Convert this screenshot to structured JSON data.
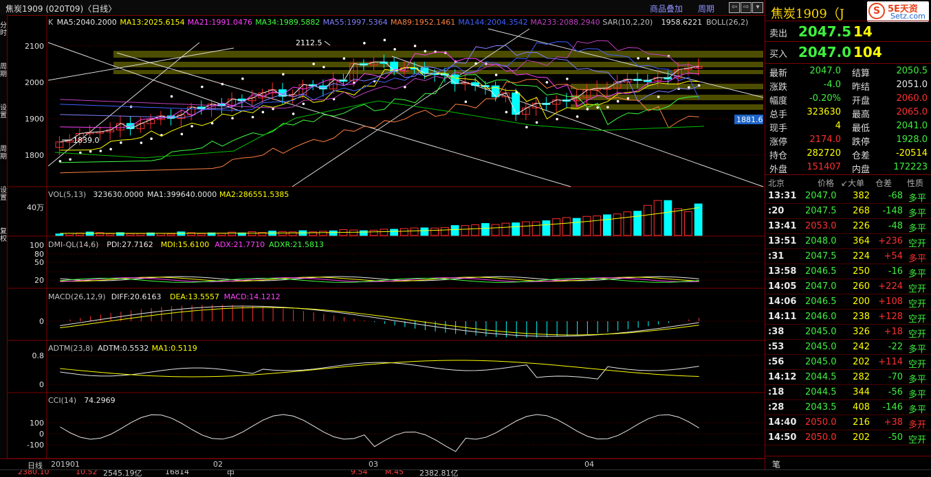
{
  "window": {
    "title": "焦炭1909 (020T09)〈日线〉",
    "links": [
      "商品叠加",
      "周期"
    ],
    "scroll_buttons": [
      "⇦",
      "⇨",
      "▾"
    ]
  },
  "left_sidebar": [
    "分时",
    "周期",
    "设置",
    "周期",
    "设置",
    "复权"
  ],
  "main_chart": {
    "indicator_line": [
      {
        "text": "K",
        "color": "#c0c0c0"
      },
      {
        "text": "MA5:2040.2000",
        "color": "#e8e8e8"
      },
      {
        "text": "MA13:2025.6154",
        "color": "#ffff00"
      },
      {
        "text": "MA21:1991.0476",
        "color": "#ff40ff"
      },
      {
        "text": "MA34:1989.5882",
        "color": "#40ff40"
      },
      {
        "text": "MA55:1997.5364",
        "color": "#8080ff"
      },
      {
        "text": "MA89:1952.1461",
        "color": "#ff8040"
      },
      {
        "text": "MA144:2004.3542",
        "color": "#4060ff"
      },
      {
        "text": "MA233:2088.2940",
        "color": "#c040c0"
      },
      {
        "text": "SAR(10,2,20)",
        "color": "#c0c0c0"
      },
      {
        "text": "1958.6221",
        "color": "#e8e8e8"
      },
      {
        "text": "BOLL(26,2)",
        "color": "#c0c0c0"
      }
    ],
    "y_ticks": [
      "2100",
      "2000",
      "1900",
      "1800"
    ],
    "annotation_high": "2112.5",
    "annotation_low": "1839.0",
    "price_marker": "1881.6"
  },
  "volume": {
    "header": [
      {
        "text": "VOL(5,13)",
        "color": "#c0c0c0"
      },
      {
        "text": "323630.0000",
        "color": "#e8e8e8"
      },
      {
        "text": "MA1:399640.0000",
        "color": "#e8e8e8"
      },
      {
        "text": "MA2:286551.5385",
        "color": "#ffff00"
      }
    ],
    "y_tick": "40万"
  },
  "dmi": {
    "header": [
      {
        "text": "DMI-QL(14,6)",
        "color": "#c0c0c0"
      },
      {
        "text": "PDI:27.7162",
        "color": "#e8e8e8"
      },
      {
        "text": "MDI:15.6100",
        "color": "#ffff00"
      },
      {
        "text": "ADX:21.7710",
        "color": "#ff40ff"
      },
      {
        "text": "ADXR:21.5813",
        "color": "#40ff40"
      }
    ],
    "y_ticks": [
      "100",
      "80",
      "50",
      "20"
    ]
  },
  "macd": {
    "header": [
      {
        "text": "MACD(26,12,9)",
        "color": "#c0c0c0"
      },
      {
        "text": "DIFF:20.6163",
        "color": "#e8e8e8"
      },
      {
        "text": "DEA:13.5557",
        "color": "#ffff00"
      },
      {
        "text": "MACD:14.1212",
        "color": "#ff40ff"
      }
    ],
    "y_tick": "0"
  },
  "adtm": {
    "header": [
      {
        "text": "ADTM(23,8)",
        "color": "#c0c0c0"
      },
      {
        "text": "ADTM:0.5532",
        "color": "#e8e8e8"
      },
      {
        "text": "MA1:0.5119",
        "color": "#ffff00"
      }
    ],
    "y_ticks": [
      "0.8",
      "0"
    ]
  },
  "cci": {
    "header": [
      {
        "text": "CCI(14)",
        "color": "#c0c0c0"
      },
      {
        "text": "74.2969",
        "color": "#e8e8e8"
      }
    ],
    "y_ticks": [
      "100",
      "0",
      "-100"
    ]
  },
  "date_axis": {
    "label": "日线",
    "dates": [
      "201901",
      "02",
      "03",
      "04"
    ]
  },
  "taskbar_fragments": [
    "2380.10",
    "10.52",
    "2545.19亿",
    "16814",
    "中",
    "9.54",
    "M.45",
    "2382.81亿"
  ],
  "quote_panel": {
    "contract": "焦炭1909（J",
    "logo_text": "5E天资",
    "logo_sub": "Setz.com",
    "sell_label": "卖出",
    "sell_price": "2047.5",
    "sell_vol": "14",
    "buy_label": "买入",
    "buy_price": "2047.0",
    "buy_vol": "104",
    "stats": [
      {
        "l": "最新",
        "v": "2047.0",
        "vc": "g",
        "l2": "结算",
        "v2": "2050.5",
        "v2c": "g"
      },
      {
        "l": "涨跌",
        "v": "-4.0",
        "vc": "g",
        "l2": "昨结",
        "v2": "2051.0",
        "v2c": "w"
      },
      {
        "l": "幅度",
        "v": "-0.20%",
        "vc": "g",
        "l2": "开盘",
        "v2": "2060.0",
        "v2c": "r"
      },
      {
        "l": "总手",
        "v": "323630",
        "vc": "y",
        "l2": "最高",
        "v2": "2065.0",
        "v2c": "r"
      },
      {
        "l": "现手",
        "v": "4",
        "vc": "y",
        "l2": "最低",
        "v2": "2041.0",
        "v2c": "g"
      },
      {
        "l": "涨停",
        "v": "2174.0",
        "vc": "r",
        "l2": "跌停",
        "v2": "1928.0",
        "v2c": "g"
      },
      {
        "l": "持仓",
        "v": "282720",
        "vc": "y",
        "l2": "仓差",
        "v2": "-20514",
        "v2c": "y"
      },
      {
        "l": "外盘",
        "v": "151407",
        "vc": "r",
        "l2": "内盘",
        "v2": "172223",
        "v2c": "g"
      }
    ],
    "ticks_header": [
      "北京",
      "价格",
      "↙大单",
      "仓差",
      "性质"
    ],
    "ticks": [
      {
        "t": "13:31",
        "p": "2047.0",
        "pc": "g",
        "v": "382",
        "c": "-68",
        "n": "多平",
        "nc": "g"
      },
      {
        "t": ":20",
        "p": "2047.5",
        "pc": "g",
        "v": "268",
        "c": "-148",
        "n": "多平",
        "nc": "g"
      },
      {
        "t": "13:41",
        "p": "2053.0",
        "pc": "r",
        "v": "226",
        "c": "-48",
        "n": "多平",
        "nc": "g"
      },
      {
        "t": "13:51",
        "p": "2048.0",
        "pc": "g",
        "v": "364",
        "c": "+236",
        "n": "空开",
        "nc": "g"
      },
      {
        "t": ":31",
        "p": "2047.5",
        "pc": "g",
        "v": "224",
        "c": "+54",
        "n": "多平",
        "nc": "r"
      },
      {
        "t": "13:58",
        "p": "2046.5",
        "pc": "g",
        "v": "250",
        "c": "-16",
        "n": "多平",
        "nc": "g"
      },
      {
        "t": "14:05",
        "p": "2047.0",
        "pc": "g",
        "v": "260",
        "c": "+224",
        "n": "空开",
        "nc": "g"
      },
      {
        "t": "14:06",
        "p": "2046.5",
        "pc": "g",
        "v": "200",
        "c": "+108",
        "n": "空开",
        "nc": "g"
      },
      {
        "t": "14:11",
        "p": "2046.0",
        "pc": "g",
        "v": "238",
        "c": "+128",
        "n": "空开",
        "nc": "g"
      },
      {
        "t": ":38",
        "p": "2045.0",
        "pc": "g",
        "v": "326",
        "c": "+18",
        "n": "空开",
        "nc": "g"
      },
      {
        "t": ":53",
        "p": "2045.0",
        "pc": "g",
        "v": "242",
        "c": "-22",
        "n": "多平",
        "nc": "g"
      },
      {
        "t": ":56",
        "p": "2045.0",
        "pc": "g",
        "v": "202",
        "c": "+114",
        "n": "空开",
        "nc": "g"
      },
      {
        "t": "14:12",
        "p": "2044.5",
        "pc": "g",
        "v": "282",
        "c": "-70",
        "n": "多平",
        "nc": "g"
      },
      {
        "t": ":18",
        "p": "2044.5",
        "pc": "g",
        "v": "344",
        "c": "-56",
        "n": "多平",
        "nc": "g"
      },
      {
        "t": ":28",
        "p": "2043.5",
        "pc": "g",
        "v": "408",
        "c": "-146",
        "n": "多平",
        "nc": "g"
      },
      {
        "t": "14:40",
        "p": "2050.0",
        "pc": "r",
        "v": "216",
        "c": "+38",
        "n": "多开",
        "nc": "r"
      },
      {
        "t": "14:50",
        "p": "2050.0",
        "pc": "r",
        "v": "202",
        "c": "-50",
        "n": "空开",
        "nc": "g"
      }
    ],
    "footer_tab": "笔"
  }
}
